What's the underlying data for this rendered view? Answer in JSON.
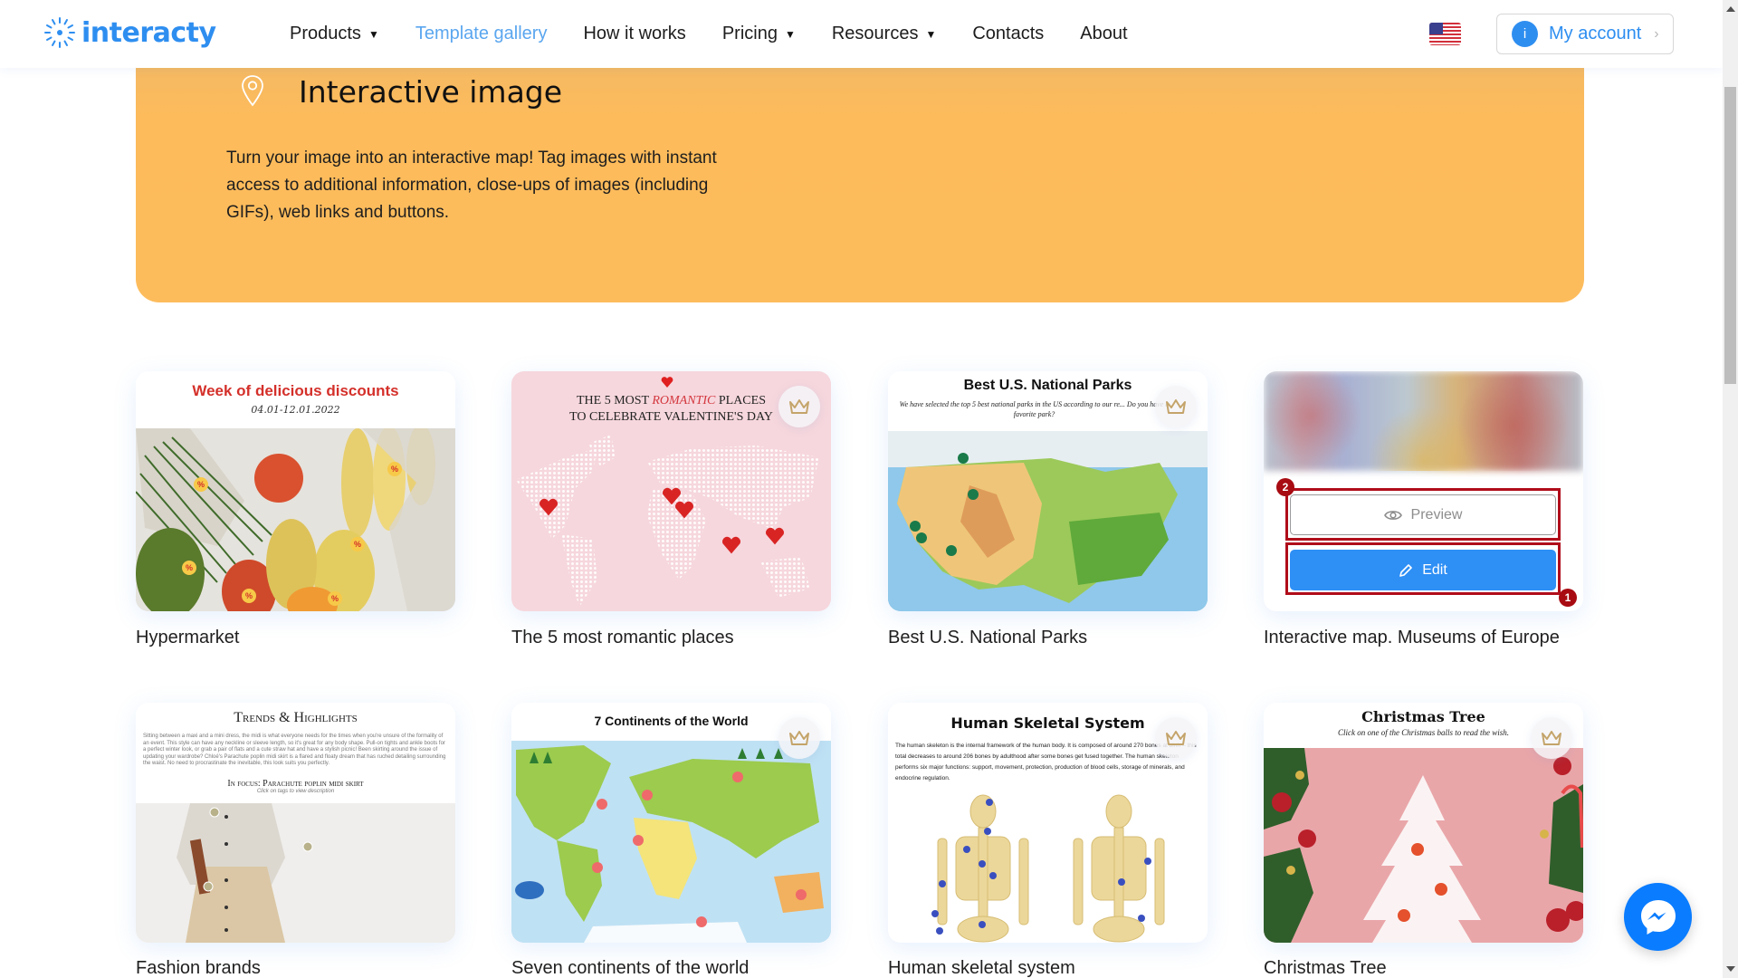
{
  "header": {
    "logo_text": "interacty",
    "nav": [
      {
        "label": "Products",
        "has_dropdown": true,
        "active": false
      },
      {
        "label": "Template gallery",
        "has_dropdown": false,
        "active": true
      },
      {
        "label": "How it works",
        "has_dropdown": false,
        "active": false
      },
      {
        "label": "Pricing",
        "has_dropdown": true,
        "active": false
      },
      {
        "label": "Resources",
        "has_dropdown": true,
        "active": false
      },
      {
        "label": "Contacts",
        "has_dropdown": false,
        "active": false
      },
      {
        "label": "About",
        "has_dropdown": false,
        "active": false
      }
    ],
    "language_flag": "us-flag-icon",
    "account": {
      "badge": "i",
      "label": "My account",
      "chevron": "›"
    }
  },
  "hero": {
    "icon": "map-pin-icon",
    "title": "Interactive image",
    "description": "Turn your image into an interactive map! Tag images with instant access to additional information, close-ups of images (including GIFs), web links and buttons."
  },
  "templates": [
    {
      "label": "Hypermarket",
      "premium": false,
      "preview_title": "Week of delicious discounts",
      "preview_subtitle": "04.01-12.01.2022"
    },
    {
      "label": "The 5 most romantic places",
      "premium": true,
      "preview_title_pre": "THE 5 MOST ",
      "preview_title_em": "ROMANTIC",
      "preview_title_post": " PLACES",
      "preview_title_line2": "TO CELEBRATE VALENTINE'S DAY"
    },
    {
      "label": "Best U.S. National Parks",
      "premium": true,
      "preview_title": "Best U.S. National Parks",
      "preview_subtitle": "We have selected the top 5 best national parks in the US according to our re... Do you have a favorite park?"
    },
    {
      "label": "Interactive map. Museums of Europe",
      "premium": false,
      "hovered": true,
      "preview_button": "Preview",
      "edit_button": "Edit",
      "annotations": [
        "1",
        "2"
      ]
    },
    {
      "label": "Fashion brands",
      "premium": false,
      "preview_title": "Trends & Highlights",
      "preview_body": "Sitting between a maxi and a mini dress, the midi is what everyone needs for the times when you're unsure of the formality of an event. This style can have any neckline or sleeve length, so it's great for any body shape. Pull-on tights and ankle boots for a perfect winter look, or grab a pair of flats and a cute straw hat and have a stylish picnic! Been skirting around the issue of updating your wardrobe? Chloé's Parachute poplin midi skirt is a flared and floaty dream that has ruched detailing surrounding the waist. No need to procrastinate the inevitable, this look suits you perfectly.",
      "preview_subtitle": "In focus: Parachute poplin midi skirt",
      "preview_hint": "Click on tags to view description"
    },
    {
      "label": "Seven continents of the world",
      "premium": true,
      "preview_title": "7 Continents of the World"
    },
    {
      "label": "Human skeletal system",
      "premium": true,
      "preview_title": "Human Skeletal System",
      "preview_body": "The human skeleton is the internal framework of the human body. It is composed of around 270 bones at birth – this total decreases to around 206 bones by adulthood after some bones get fused together. The human skeleton performs six major functions: support, movement, protection, production of blood cells, storage of minerals, and endocrine regulation."
    },
    {
      "label": "Christmas Tree",
      "premium": true,
      "preview_title": "Christmas Tree",
      "preview_subtitle": "Click on one of the Christmas balls to read the wish."
    }
  ],
  "widgets": {
    "messenger": "messenger-icon"
  },
  "colors": {
    "brand": "#2e8ef0",
    "hero_bg": "#fdbc5c",
    "edit_button": "#2e8ff5",
    "annotation": "#b00d1a",
    "nav_active": "#5aa6ef"
  }
}
